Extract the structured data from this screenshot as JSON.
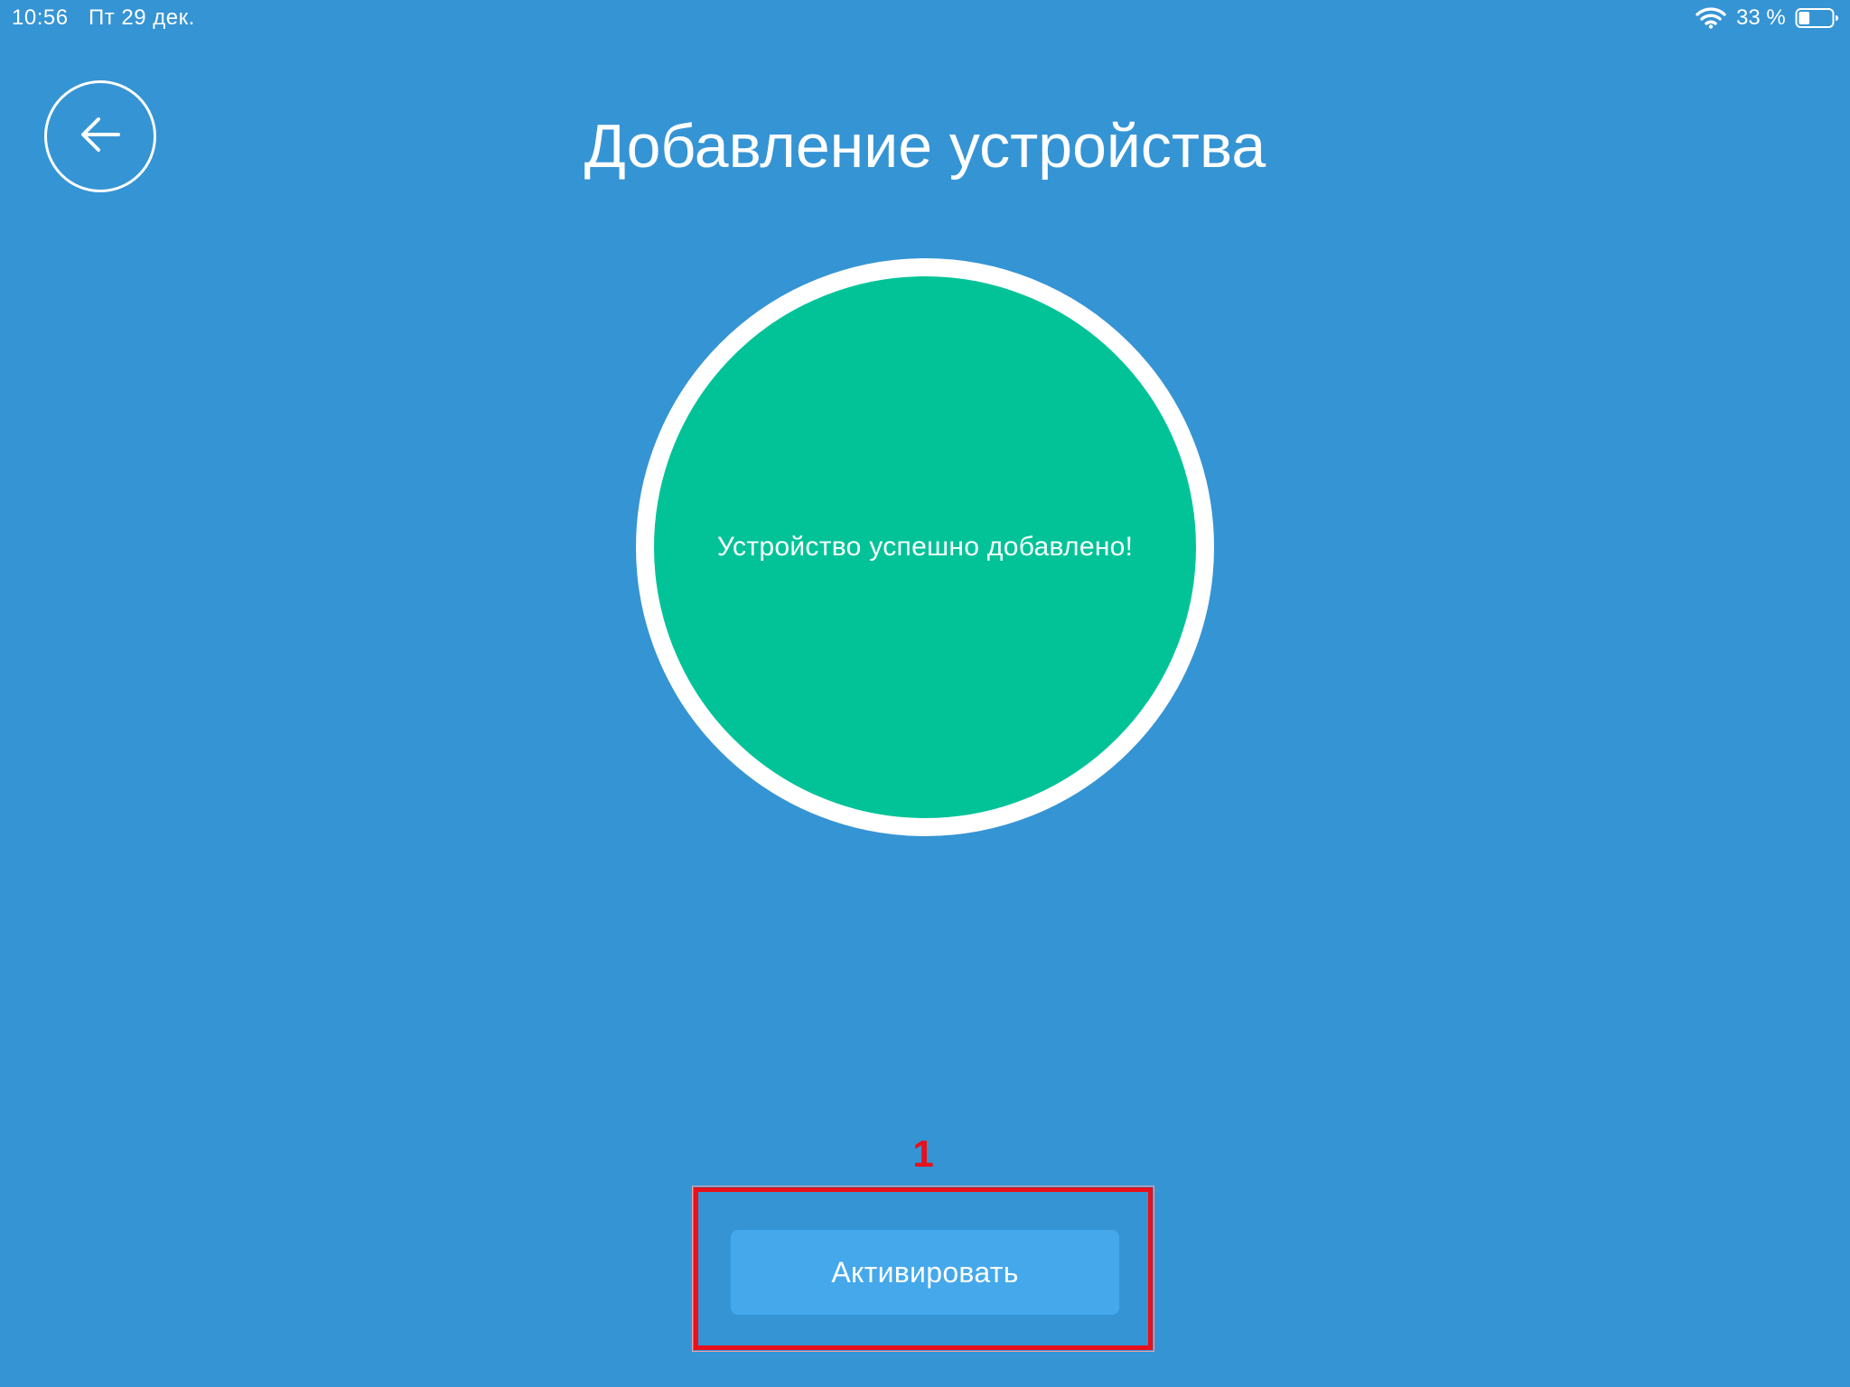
{
  "status_bar": {
    "time": "10:56",
    "date": "Пт 29 дек.",
    "battery_percent": "33 %",
    "battery_level": 0.33,
    "wifi_icon": "wifi-icon",
    "battery_icon": "battery-icon"
  },
  "header": {
    "title": "Добавление устройства",
    "back_icon": "arrow-left-icon"
  },
  "main": {
    "status_message": "Устройство успешно добавлено!",
    "circle_color": "#02C398"
  },
  "footer": {
    "annotation_number": "1",
    "annotation_color": "#E8101A",
    "activate_label": "Активировать",
    "button_color": "#45A8EB"
  },
  "colors": {
    "background": "#3594D4",
    "text": "#FFFFFF"
  }
}
